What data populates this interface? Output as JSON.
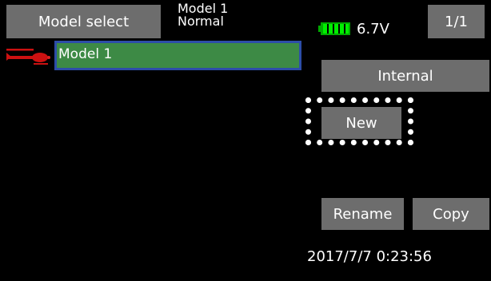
{
  "header": {
    "title": "Model select",
    "model_name": "Model 1",
    "model_mode": "Normal",
    "voltage": "6.7V",
    "page_indicator": "1/1"
  },
  "models": {
    "items": [
      {
        "label": "Model 1",
        "selected": true
      }
    ]
  },
  "buttons": {
    "internal": "Internal",
    "new": "New",
    "rename": "Rename",
    "copy": "Copy"
  },
  "status": {
    "datetime": "2017/7/7 0:23:56"
  },
  "icons": {
    "model_type": "helicopter-icon",
    "battery": "battery-icon"
  },
  "colors": {
    "background": "#000000",
    "button": "#6d6d6d",
    "selected_row": "#3d8a45",
    "selected_border": "#2d4da8",
    "battery": "#00cc00",
    "helicopter": "#cc1111"
  }
}
